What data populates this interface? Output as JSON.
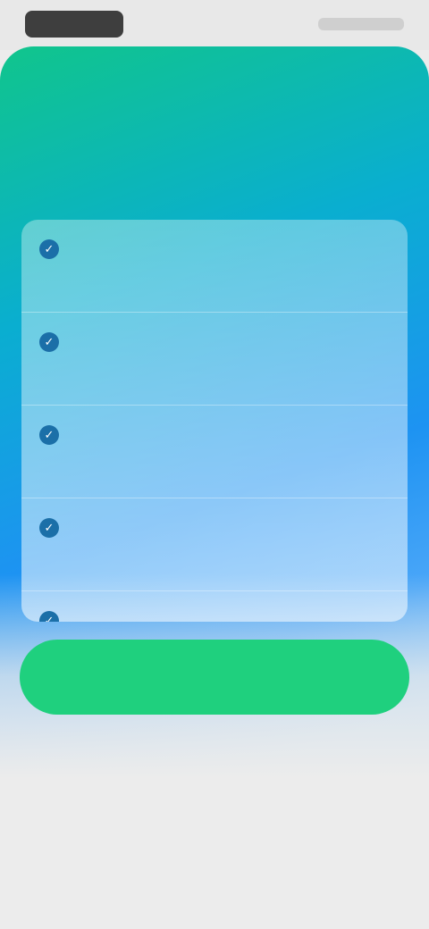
{
  "status_bar": {
    "time": "",
    "indicators": ""
  },
  "paywall": {
    "title": "",
    "features": [
      {
        "title": "",
        "description": "",
        "icon": "check-icon"
      },
      {
        "title": "",
        "description": "",
        "icon": "check-icon"
      },
      {
        "title": "",
        "description": "",
        "icon": "check-icon"
      },
      {
        "title": "",
        "description": "",
        "icon": "check-icon"
      },
      {
        "title": "",
        "description": "",
        "icon": "check-icon"
      }
    ],
    "cta_label": "",
    "terms_text": "",
    "terms_link": "",
    "secondary_link": "",
    "footer_links": [
      "",
      "",
      "",
      ""
    ]
  },
  "colors": {
    "accent": "#1fd07e",
    "gradient_start": "#10c58c",
    "gradient_end": "#1d93f2",
    "background": "#ececec"
  }
}
